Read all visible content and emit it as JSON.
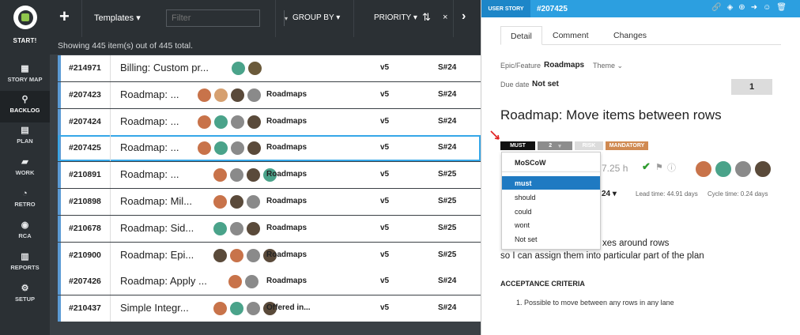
{
  "sidebar": {
    "start_label": "START!",
    "items": [
      {
        "icon": "grid-icon",
        "glyph": "▦",
        "label": "STORY MAP"
      },
      {
        "icon": "pin-icon",
        "glyph": "⚲",
        "label": "BACKLOG"
      },
      {
        "icon": "list-icon",
        "glyph": "▤",
        "label": "PLAN"
      },
      {
        "icon": "briefcase-icon",
        "glyph": "▰",
        "label": "WORK"
      },
      {
        "icon": "chat-icon",
        "glyph": "◔",
        "label": "RETRO"
      },
      {
        "icon": "people-icon",
        "glyph": "◉",
        "label": "RCA"
      },
      {
        "icon": "chart-icon",
        "glyph": "▥",
        "label": "REPORTS"
      },
      {
        "icon": "gear-icon",
        "glyph": "⚙",
        "label": "SETUP"
      }
    ]
  },
  "toolbar": {
    "add_glyph": "+",
    "templates_label": "Templates ▾",
    "filter_placeholder": "Filter",
    "filter_dd_glyph": "▾",
    "groupby_label": "GROUP BY ▾",
    "priority_label": "PRIORITY ▾",
    "sort_glyph": "⇅",
    "close_glyph": "×",
    "next_glyph": "›"
  },
  "info": {
    "showing_text": "Showing 445 item(s) out of 445 total."
  },
  "rows": [
    {
      "id": "#214971",
      "title": "Billing: Custom pr...",
      "avatars": [
        "#4aa38a",
        "#6b5a3a"
      ],
      "epic": "",
      "release": "v5",
      "sprint": "S#24"
    },
    {
      "id": "#207423",
      "title": "Roadmap: ...",
      "avatars": [
        "#c8734a",
        "#d6a070",
        "#5a4a3a",
        "#8a8a8a"
      ],
      "epic": "Roadmaps",
      "release": "v5",
      "sprint": "S#24"
    },
    {
      "id": "#207424",
      "title": "Roadmap: ...",
      "avatars": [
        "#c8734a",
        "#4aa38a",
        "#8a8a8a",
        "#5a4a3a"
      ],
      "epic": "Roadmaps",
      "release": "v5",
      "sprint": "S#24"
    },
    {
      "id": "#207425",
      "title": "Roadmap: ...",
      "avatars": [
        "#c8734a",
        "#4aa38a",
        "#8a8a8a",
        "#5a4a3a"
      ],
      "epic": "Roadmaps",
      "release": "v5",
      "sprint": "S#24",
      "selected": true
    },
    {
      "id": "#210891",
      "title": "Roadmap: ...",
      "avatars": [
        "#c8734a",
        "#8a8a8a",
        "#5a4a3a",
        "#4aa38a"
      ],
      "epic": "Roadmaps",
      "release": "v5",
      "sprint": "S#25"
    },
    {
      "id": "#210898",
      "title": "Roadmap: Mil...",
      "avatars": [
        "#c8734a",
        "#5a4a3a",
        "#8a8a8a"
      ],
      "epic": "Roadmaps",
      "release": "v5",
      "sprint": "S#25"
    },
    {
      "id": "#210678",
      "title": "Roadmap: Sid...",
      "avatars": [
        "#4aa38a",
        "#8a8a8a",
        "#5a4a3a"
      ],
      "epic": "Roadmaps",
      "release": "v5",
      "sprint": "S#25"
    },
    {
      "id": "#210900",
      "title": "Roadmap: Epi...",
      "avatars": [
        "#5a4a3a",
        "#c8734a",
        "#8a8a8a",
        "#5a4a3a"
      ],
      "epic": "Roadmaps",
      "release": "v5",
      "sprint": "S#25"
    },
    {
      "id": "#207426",
      "title": "Roadmap: Apply ...",
      "avatars": [
        "#c8734a",
        "#8a8a8a"
      ],
      "epic": "Roadmaps",
      "release": "v5",
      "sprint": "S#24"
    },
    {
      "id": "#210437",
      "title": "Simple Integr...",
      "avatars": [
        "#c8734a",
        "#4aa38a",
        "#8a8a8a",
        "#5a4a3a"
      ],
      "epic": "Offered in...",
      "release": "v5",
      "sprint": "S#24"
    }
  ],
  "panel": {
    "type_label": "USER STORY",
    "item_id": "#207425",
    "header_icons": [
      {
        "name": "link-icon",
        "glyph": "🔗"
      },
      {
        "name": "paint-icon",
        "glyph": "◈"
      },
      {
        "name": "plus-circle-icon",
        "glyph": "⊕"
      },
      {
        "name": "arrow-circle-icon",
        "glyph": "➜"
      },
      {
        "name": "smile-icon",
        "glyph": "☺"
      },
      {
        "name": "trash-icon",
        "glyph": "🗑"
      }
    ],
    "tabs": [
      "Detail",
      "Comment",
      "Changes"
    ],
    "epic_label": "Epic/Feature",
    "epic_value": "Roadmaps",
    "theme_label": "Theme ⌄",
    "due_label": "Due date",
    "due_value": "Not set",
    "points": "1",
    "title": "Roadmap: Move items between rows",
    "badges": {
      "must": "MUST",
      "two": "2",
      "two_arrow": "▾",
      "risk": "RISK",
      "mandatory": "MANDATORY"
    },
    "moscow": {
      "header": "MoSCoW",
      "options": [
        "must",
        "should",
        "could",
        "wont",
        "Not set"
      ],
      "selected": "must"
    },
    "effort": "7.25 h",
    "check_glyph": "✔",
    "flag_glyph": "⚑",
    "info_glyph": "ⓘ",
    "avatars": [
      "#c8734a",
      "#4aa38a",
      "#8a8a8a",
      "#5a4a3a"
    ],
    "sprint_value": "24 ▾",
    "lead_time": "Lead time: 44.91 days",
    "cycle_time": "Cycle time: 0.24 days",
    "desc_line1": "xes around rows",
    "desc_line2": "so I can assign them into particular part of the plan",
    "acceptance_header": "ACCEPTANCE CRITERIA",
    "acceptance_items": [
      "1.  Possible to move between any rows in any lane"
    ]
  },
  "colors": {
    "accent": "#2c9fe0",
    "dark": "#2b3034",
    "selected": "#1f7ac2",
    "mandatory": "#d08a52"
  }
}
